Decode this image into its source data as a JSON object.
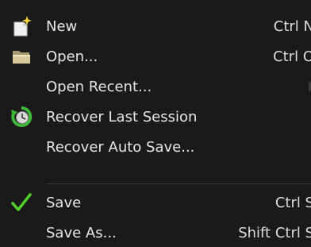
{
  "menu": {
    "items": [
      {
        "label": "New",
        "shortcut": "Ctrl N",
        "icon": "new-file-icon"
      },
      {
        "label": "Open...",
        "shortcut": "Ctrl O",
        "icon": "folder-icon"
      },
      {
        "label": "Open Recent...",
        "shortcut": "",
        "icon": "",
        "has_submenu": true
      },
      {
        "label": "Recover Last Session",
        "shortcut": "",
        "icon": "recover-icon"
      },
      {
        "label": "Recover Auto Save...",
        "shortcut": "",
        "icon": ""
      },
      {
        "label": "Save",
        "shortcut": "Ctrl S",
        "icon": "check-icon"
      },
      {
        "label": "Save As...",
        "shortcut": "Shift Ctrl S",
        "icon": ""
      }
    ]
  },
  "colors": {
    "background": "#1a1a1a",
    "text": "#e6e6e6",
    "check": "#4fd12a",
    "folder": "#c8b98a"
  }
}
